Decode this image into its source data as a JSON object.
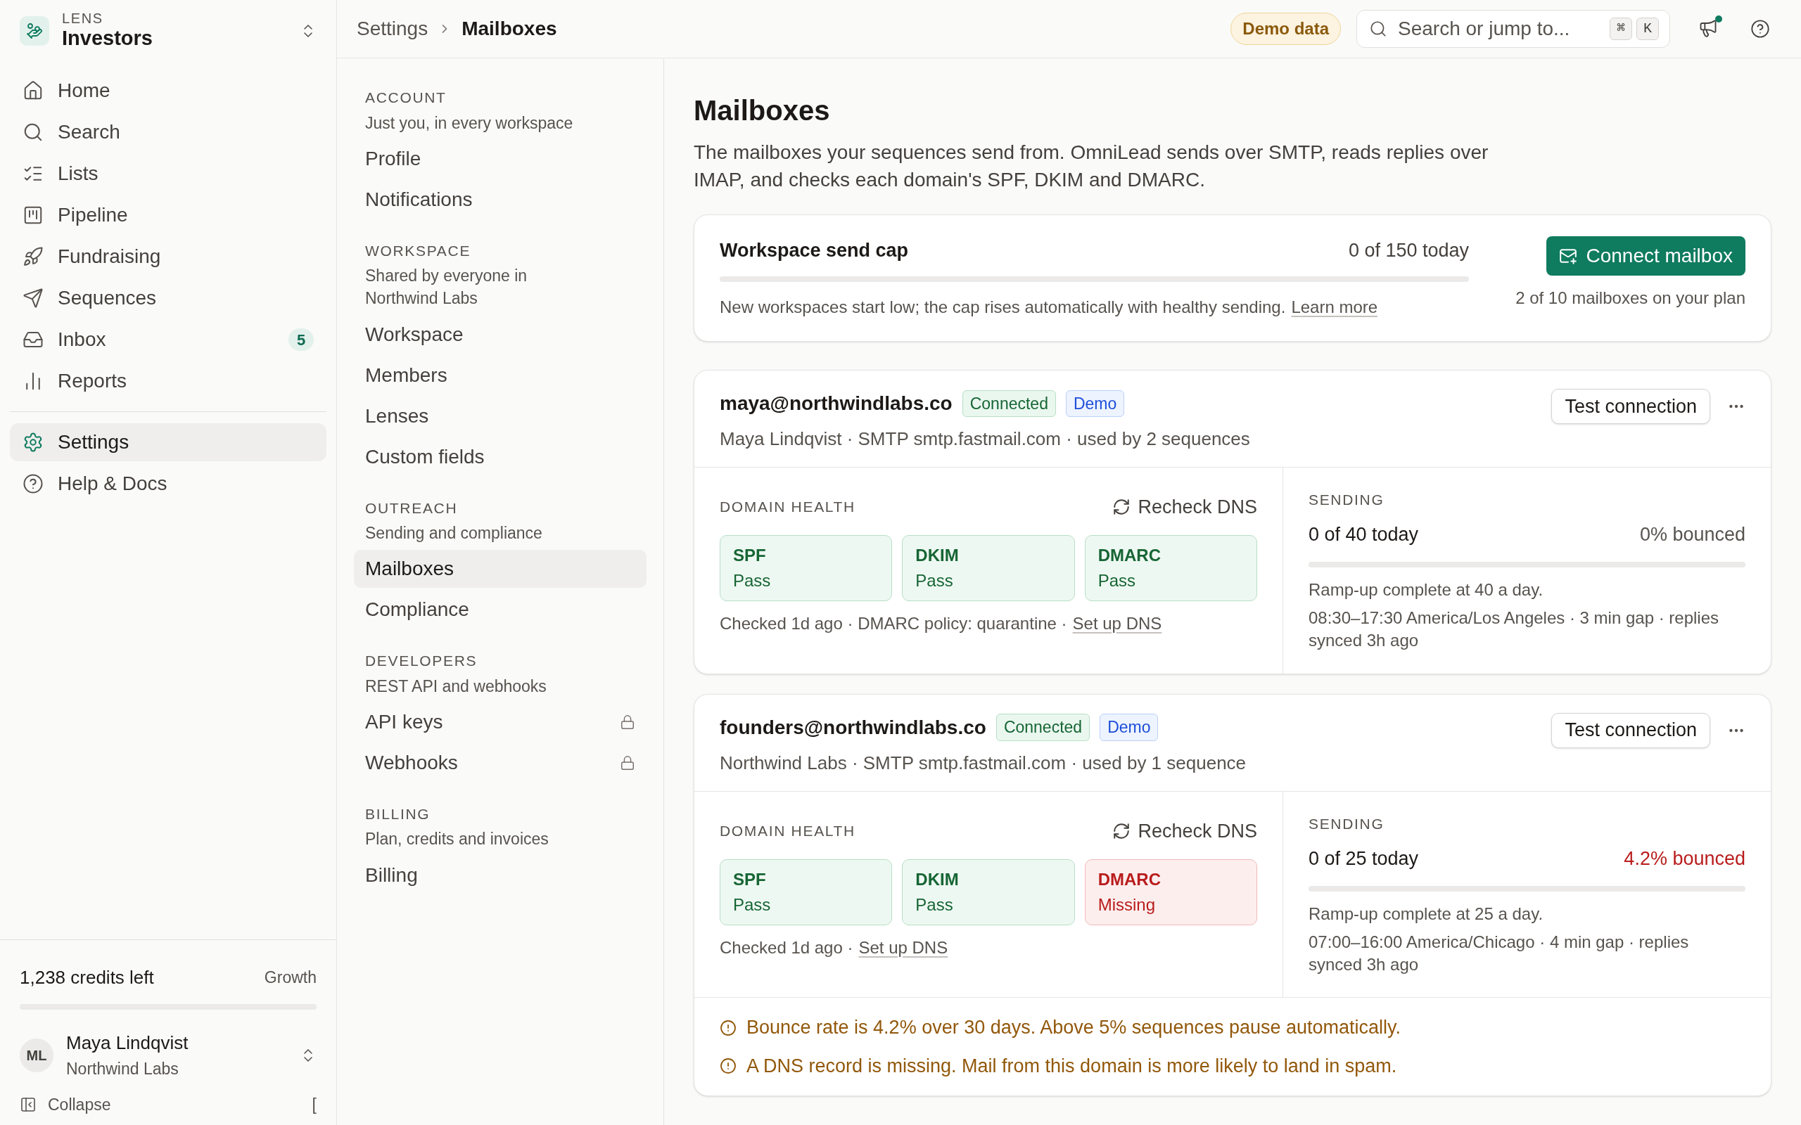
{
  "workspace": {
    "label": "LENS",
    "name": "Investors"
  },
  "nav": [
    {
      "label": "Home",
      "selected": false
    },
    {
      "label": "Search",
      "selected": false
    },
    {
      "label": "Lists",
      "selected": false
    },
    {
      "label": "Pipeline",
      "selected": false
    },
    {
      "label": "Fundraising",
      "selected": false
    },
    {
      "label": "Sequences",
      "selected": false
    },
    {
      "label": "Inbox",
      "selected": false,
      "count": "5"
    },
    {
      "label": "Reports",
      "selected": false
    }
  ],
  "nav_secondary": [
    {
      "label": "Settings",
      "selected": true
    },
    {
      "label": "Help & Docs",
      "selected": false
    }
  ],
  "credits": {
    "text": "1,238 credits left",
    "plan": "Growth"
  },
  "user": {
    "initials": "ML",
    "name": "Maya Lindqvist",
    "org": "Northwind Labs"
  },
  "collapse": {
    "label": "Collapse",
    "shortcut": "["
  },
  "breadcrumb": [
    "Settings",
    "Mailboxes"
  ],
  "demo_badge": "Demo data",
  "search": {
    "placeholder": "Search or jump to...",
    "keys": [
      "⌘",
      "K"
    ]
  },
  "notifications": {
    "unread": true
  },
  "settings_nav": [
    {
      "heading": "ACCOUNT",
      "subtitle": "Just you, in every workspace",
      "items": [
        {
          "label": "Profile",
          "selected": false,
          "locked": false
        },
        {
          "label": "Notifications",
          "selected": false,
          "locked": false
        }
      ]
    },
    {
      "heading": "WORKSPACE",
      "subtitle": "Shared by everyone in Northwind Labs",
      "items": [
        {
          "label": "Workspace",
          "selected": false,
          "locked": false
        },
        {
          "label": "Members",
          "selected": false,
          "locked": false
        },
        {
          "label": "Lenses",
          "selected": false,
          "locked": false
        },
        {
          "label": "Custom fields",
          "selected": false,
          "locked": false
        }
      ]
    },
    {
      "heading": "OUTREACH",
      "subtitle": "Sending and compliance",
      "items": [
        {
          "label": "Mailboxes",
          "selected": true,
          "locked": false
        },
        {
          "label": "Compliance",
          "selected": false,
          "locked": false
        }
      ]
    },
    {
      "heading": "DEVELOPERS",
      "subtitle": "REST API and webhooks",
      "items": [
        {
          "label": "API keys",
          "selected": false,
          "locked": true
        },
        {
          "label": "Webhooks",
          "selected": false,
          "locked": true
        }
      ]
    },
    {
      "heading": "BILLING",
      "subtitle": "Plan, credits and invoices",
      "items": [
        {
          "label": "Billing",
          "selected": false,
          "locked": false
        }
      ]
    }
  ],
  "page": {
    "title": "Mailboxes",
    "description": "The mailboxes your sequences send from. OmniLead sends over SMTP, reads replies over IMAP, and checks each domain's SPF, DKIM and DMARC."
  },
  "send_cap": {
    "title": "Workspace send cap",
    "reading": "0 of 150 today",
    "note": "New workspaces start low; the cap rises automatically with healthy sending.",
    "link": "Learn more",
    "button": "Connect mailbox",
    "plan_usage": "2 of 10 mailboxes on your plan"
  },
  "mailboxes": [
    {
      "email": "maya@northwindlabs.co",
      "badges": [
        {
          "label": "Connected",
          "kind": "status"
        },
        {
          "label": "Demo",
          "kind": "demo"
        }
      ],
      "meta": "Maya Lindqvist · SMTP smtp.fastmail.com · used by 2 sequences",
      "test_button": "Test connection",
      "health_label": "DOMAIN HEALTH",
      "recheck": "Recheck DNS",
      "checks": [
        {
          "name": "SPF",
          "status": "Pass",
          "ok": true
        },
        {
          "name": "DKIM",
          "status": "Pass",
          "ok": true
        },
        {
          "name": "DMARC",
          "status": "Pass",
          "ok": true
        }
      ],
      "checked_note": "Checked 1d ago · DMARC policy: quarantine ·",
      "setup_link": "Set up DNS",
      "sending_label": "SENDING",
      "sent": "0 of 40 today",
      "bounced": "0% bounced",
      "bounce_alert": false,
      "ramp": "Ramp-up complete at 40 a day.",
      "schedule": "08:30–17:30 America/Los Angeles · 3 min gap · replies synced 3h ago"
    },
    {
      "email": "founders@northwindlabs.co",
      "badges": [
        {
          "label": "Connected",
          "kind": "status"
        },
        {
          "label": "Demo",
          "kind": "demo"
        }
      ],
      "meta": "Northwind Labs · SMTP smtp.fastmail.com · used by 1 sequence",
      "test_button": "Test connection",
      "health_label": "DOMAIN HEALTH",
      "recheck": "Recheck DNS",
      "checks": [
        {
          "name": "SPF",
          "status": "Pass",
          "ok": true
        },
        {
          "name": "DKIM",
          "status": "Pass",
          "ok": true
        },
        {
          "name": "DMARC",
          "status": "Missing",
          "ok": false
        }
      ],
      "checked_note": "Checked 1d ago ·",
      "setup_link": "Set up DNS",
      "sending_label": "SENDING",
      "sent": "0 of 25 today",
      "bounced": "4.2% bounced",
      "bounce_alert": true,
      "ramp": "Ramp-up complete at 25 a day.",
      "schedule": "07:00–16:00 America/Chicago · 4 min gap · replies synced 3h ago",
      "warnings": [
        "Bounce rate is 4.2% over 30 days. Above 5% sequences pause automatically.",
        "A DNS record is missing. Mail from this domain is more likely to land in spam."
      ]
    }
  ]
}
